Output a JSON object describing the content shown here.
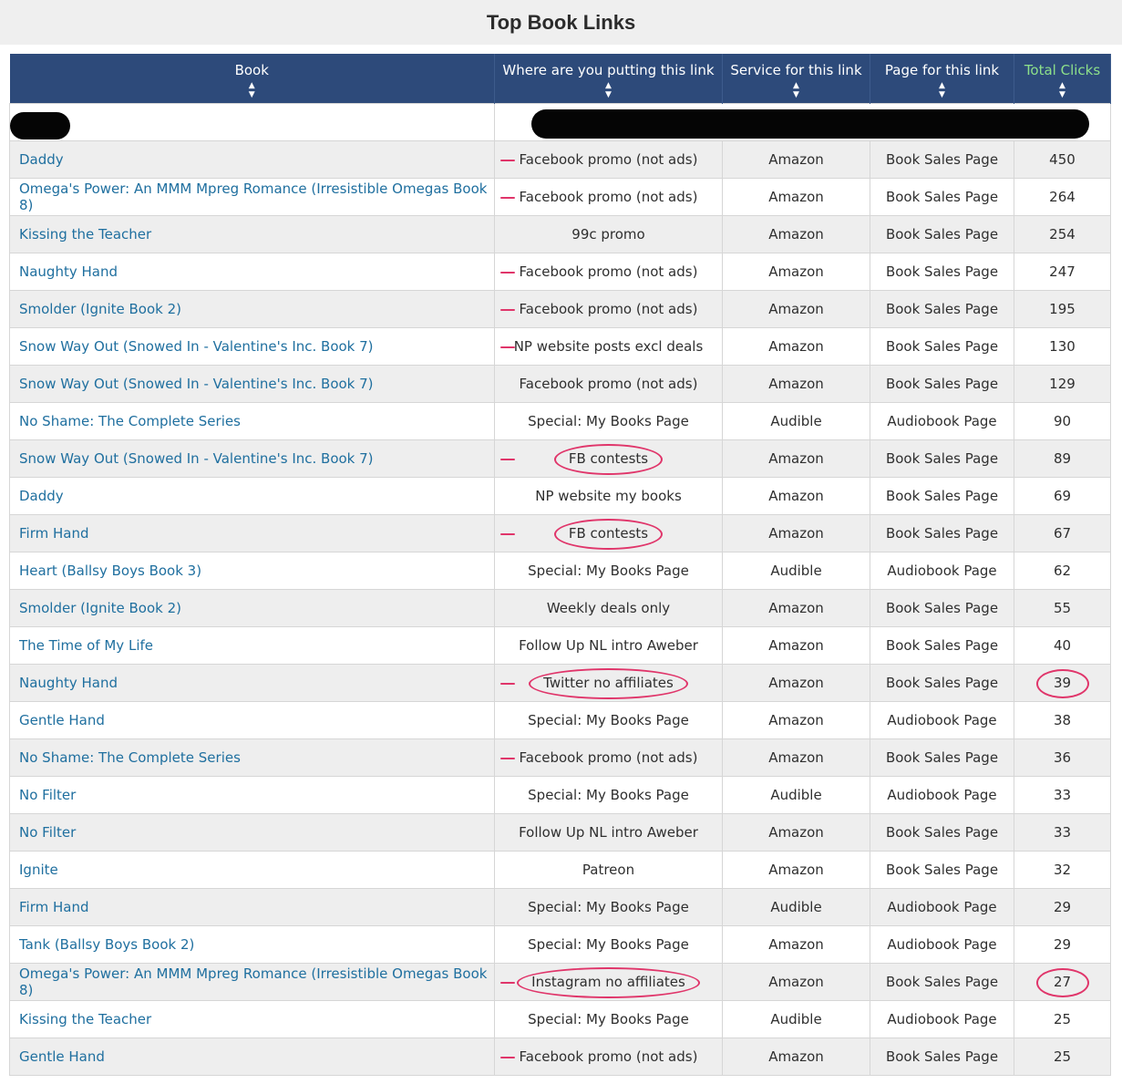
{
  "page": {
    "title": "Top Book Links"
  },
  "table": {
    "headers": [
      "Book",
      "Where are you putting this link",
      "Service for this link",
      "Page for this link",
      "Total Clicks"
    ],
    "sort_icon": "sort-updown-icon",
    "rows": [
      {
        "book": "Daddy",
        "where": "Facebook promo (not ads)",
        "service": "Amazon",
        "page": "Book Sales Page",
        "clicks": "450"
      },
      {
        "book": "Omega's Power: An MMM Mpreg Romance (Irresistible Omegas Book 8)",
        "where": "Facebook promo (not ads)",
        "service": "Amazon",
        "page": "Book Sales Page",
        "clicks": "264"
      },
      {
        "book": "Kissing the Teacher",
        "where": "99c promo",
        "service": "Amazon",
        "page": "Book Sales Page",
        "clicks": "254"
      },
      {
        "book": "Naughty Hand",
        "where": "Facebook promo (not ads)",
        "service": "Amazon",
        "page": "Book Sales Page",
        "clicks": "247"
      },
      {
        "book": "Smolder (Ignite Book 2)",
        "where": "Facebook promo (not ads)",
        "service": "Amazon",
        "page": "Book Sales Page",
        "clicks": "195"
      },
      {
        "book": "Snow Way Out (Snowed In - Valentine's Inc. Book 7)",
        "where": "NP website posts excl deals",
        "service": "Amazon",
        "page": "Book Sales Page",
        "clicks": "130"
      },
      {
        "book": "Snow Way Out (Snowed In - Valentine's Inc. Book 7)",
        "where": "Facebook promo (not ads)",
        "service": "Amazon",
        "page": "Book Sales Page",
        "clicks": "129"
      },
      {
        "book": "No Shame: The Complete Series",
        "where": "Special: My Books Page",
        "service": "Audible",
        "page": "Audiobook Page",
        "clicks": "90"
      },
      {
        "book": "Snow Way Out (Snowed In - Valentine's Inc. Book 7)",
        "where": "FB contests",
        "service": "Amazon",
        "page": "Book Sales Page",
        "clicks": "89"
      },
      {
        "book": "Daddy",
        "where": "NP website my books",
        "service": "Amazon",
        "page": "Book Sales Page",
        "clicks": "69"
      },
      {
        "book": "Firm Hand",
        "where": "FB contests",
        "service": "Amazon",
        "page": "Book Sales Page",
        "clicks": "67"
      },
      {
        "book": "Heart (Ballsy Boys Book 3)",
        "where": "Special: My Books Page",
        "service": "Audible",
        "page": "Audiobook Page",
        "clicks": "62"
      },
      {
        "book": "Smolder (Ignite Book 2)",
        "where": "Weekly deals only",
        "service": "Amazon",
        "page": "Book Sales Page",
        "clicks": "55"
      },
      {
        "book": "The Time of My Life",
        "where": "Follow Up NL intro Aweber",
        "service": "Amazon",
        "page": "Book Sales Page",
        "clicks": "40"
      },
      {
        "book": "Naughty Hand",
        "where": "Twitter no affiliates",
        "service": "Amazon",
        "page": "Book Sales Page",
        "clicks": "39"
      },
      {
        "book": "Gentle Hand",
        "where": "Special: My Books Page",
        "service": "Amazon",
        "page": "Audiobook Page",
        "clicks": "38"
      },
      {
        "book": "No Shame: The Complete Series",
        "where": "Facebook promo (not ads)",
        "service": "Amazon",
        "page": "Book Sales Page",
        "clicks": "36"
      },
      {
        "book": "No Filter",
        "where": "Special: My Books Page",
        "service": "Audible",
        "page": "Audiobook Page",
        "clicks": "33"
      },
      {
        "book": "No Filter",
        "where": "Follow Up NL intro Aweber",
        "service": "Amazon",
        "page": "Book Sales Page",
        "clicks": "33"
      },
      {
        "book": "Ignite",
        "where": "Patreon",
        "service": "Amazon",
        "page": "Book Sales Page",
        "clicks": "32"
      },
      {
        "book": "Firm Hand",
        "where": "Special: My Books Page",
        "service": "Audible",
        "page": "Audiobook Page",
        "clicks": "29"
      },
      {
        "book": "Tank (Ballsy Boys Book 2)",
        "where": "Special: My Books Page",
        "service": "Amazon",
        "page": "Audiobook Page",
        "clicks": "29"
      },
      {
        "book": "Omega's Power: An MMM Mpreg Romance (Irresistible Omegas Book 8)",
        "where": "Instagram no affiliates",
        "service": "Amazon",
        "page": "Book Sales Page",
        "clicks": "27"
      },
      {
        "book": "Kissing the Teacher",
        "where": "Special: My Books Page",
        "service": "Audible",
        "page": "Audiobook Page",
        "clicks": "25"
      },
      {
        "book": "Gentle Hand",
        "where": "Facebook promo (not ads)",
        "service": "Amazon",
        "page": "Book Sales Page",
        "clicks": "25"
      }
    ]
  },
  "annotations": {
    "color": "#e0356a",
    "dash_rows": [
      0,
      1,
      3,
      4,
      5,
      8,
      10,
      14,
      16,
      22,
      24
    ],
    "circled_where_rows": [
      8,
      10,
      14,
      22
    ],
    "circled_click_rows": [
      14,
      22
    ]
  },
  "colors": {
    "header_bg": "#2d4a7a",
    "header_text": "#ffffff",
    "highlight_header": "#8de08a",
    "link": "#1f6f9f",
    "stripe": "#eeeeee"
  }
}
